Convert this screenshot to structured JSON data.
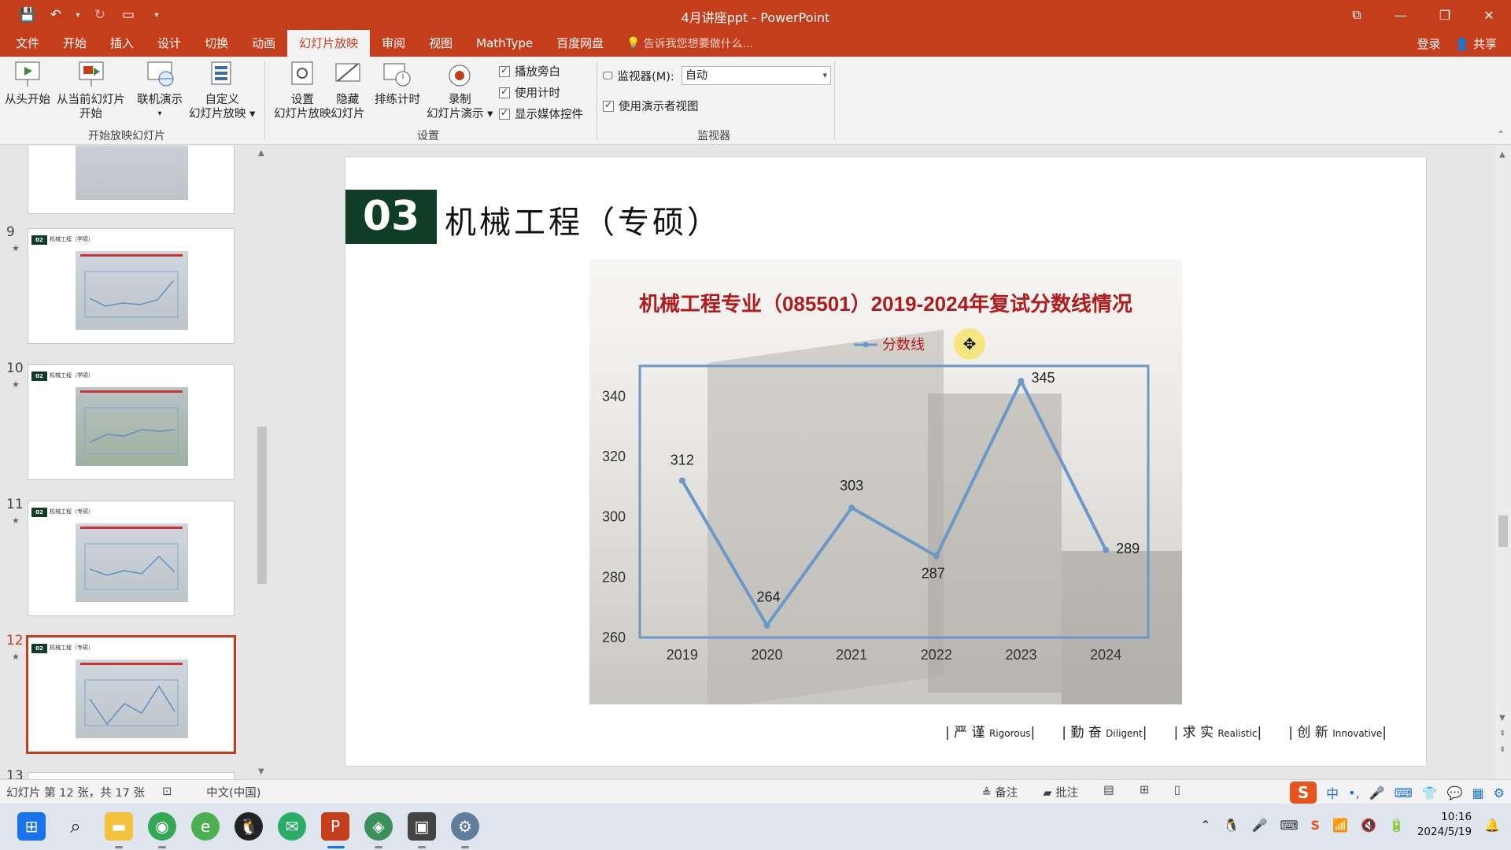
{
  "window": {
    "title": "4月讲座ppt - PowerPoint",
    "qat_icons": [
      "save-icon",
      "undo-icon",
      "redo-icon",
      "slideshow-icon",
      "customize-icon"
    ]
  },
  "tabs": [
    "文件",
    "开始",
    "插入",
    "设计",
    "切换",
    "动画",
    "幻灯片放映",
    "审阅",
    "视图",
    "MathType",
    "百度网盘"
  ],
  "active_tab": "幻灯片放映",
  "tell_me": "告诉我您想要做什么...",
  "account": {
    "login": "登录",
    "share": "共享"
  },
  "ribbon": {
    "start_group": {
      "label": "开始放映幻灯片",
      "from_start": "从头开始",
      "from_current_1": "从当前幻灯片",
      "from_current_2": "开始",
      "online": "联机演示",
      "custom_1": "自定义",
      "custom_2": "幻灯片放映"
    },
    "setup_group": {
      "label": "设置",
      "setup_1": "设置",
      "setup_2": "幻灯片放映",
      "hide_1": "隐藏",
      "hide_2": "幻灯片",
      "rehearse": "排练计时",
      "record_1": "录制",
      "record_2": "幻灯片演示",
      "play_narration": "播放旁白",
      "use_timings": "使用计时",
      "show_media": "显示媒体控件"
    },
    "monitor_group": {
      "label": "监视器",
      "monitor_label": "监视器(M):",
      "monitor_value": "自动",
      "presenter_view": "使用演示者视图"
    }
  },
  "thumbnails": [
    {
      "num": "9",
      "label": "机械工程（学硕）"
    },
    {
      "num": "10",
      "label": "机械工程（学硕）"
    },
    {
      "num": "11",
      "label": "机械工程（专硕）"
    },
    {
      "num": "12",
      "label": "机械工程（专硕）"
    },
    {
      "num": "13",
      "label": ""
    }
  ],
  "slide": {
    "section_number": "03",
    "section_title": "机械工程（专硕）",
    "footer": [
      {
        "cn": "严 谨",
        "en": "Rigorous"
      },
      {
        "cn": "勤 奋",
        "en": "Diligent"
      },
      {
        "cn": "求 实",
        "en": "Realistic"
      },
      {
        "cn": "创 新",
        "en": "Innovative"
      }
    ]
  },
  "chart_data": {
    "type": "line",
    "title": "机械工程专业（085501）2019-2024年复试分数线情况",
    "categories": [
      "2019",
      "2020",
      "2021",
      "2022",
      "2023",
      "2024"
    ],
    "series": [
      {
        "name": "分数线",
        "values": [
          312,
          264,
          303,
          287,
          345,
          289
        ]
      }
    ],
    "yticks": [
      "260",
      "280",
      "300",
      "320",
      "340"
    ],
    "ylim": [
      260,
      350
    ],
    "legend": "top",
    "line_color": "#6a98c8",
    "title_color": "#b01b1b"
  },
  "status": {
    "slide_info": "幻灯片 第 12 张，共 17 张",
    "language": "中文(中国)",
    "notes": "备注",
    "comments": "批注"
  },
  "ime": {
    "logo": "S",
    "mode": "中"
  },
  "clock": {
    "time": "10:16",
    "date": "2024/5/19"
  }
}
